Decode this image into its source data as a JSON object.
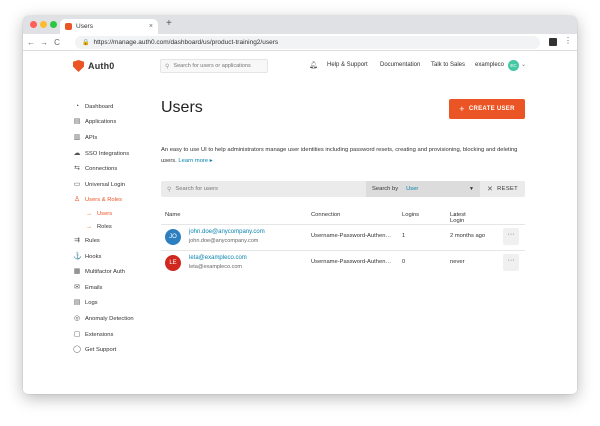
{
  "browser": {
    "tab_title": "Users",
    "tab_close": "×",
    "new_tab": "+",
    "url": "https://manage.auth0.com/dashboard/us/product-training2/users",
    "back": "←",
    "forward": "→",
    "reload": "C",
    "lock": "🔒",
    "menu": "⋮"
  },
  "header": {
    "logo_text": "Auth0",
    "search_placeholder": "Search for users or applications",
    "links": [
      "Help & Support",
      "Documentation",
      "Talk to Sales"
    ],
    "tenant_name": "exampleco",
    "tenant_initials": "EC",
    "tenant_caret": "⌄"
  },
  "sidebar": {
    "items": [
      {
        "label": "Dashboard",
        "icon": "◔"
      },
      {
        "label": "Applications",
        "icon": "▤"
      },
      {
        "label": "APIs",
        "icon": "▥"
      },
      {
        "label": "SSO Integrations",
        "icon": "☁"
      },
      {
        "label": "Connections",
        "icon": "⇆"
      },
      {
        "label": "Universal Login",
        "icon": "▭"
      },
      {
        "label": "Users & Roles",
        "icon": "♙"
      }
    ],
    "sub_items": [
      {
        "label": "Users",
        "arrow": "→"
      },
      {
        "label": "Roles",
        "arrow": "→"
      }
    ],
    "items_after": [
      {
        "label": "Rules",
        "icon": "⇉"
      },
      {
        "label": "Hooks",
        "icon": "⚓"
      },
      {
        "label": "Multifactor Auth",
        "icon": "▦"
      },
      {
        "label": "Emails",
        "icon": "✉"
      },
      {
        "label": "Logs",
        "icon": "▤"
      },
      {
        "label": "Anomaly Detection",
        "icon": "◎"
      },
      {
        "label": "Extensions",
        "icon": "▢"
      },
      {
        "label": "Get Support",
        "icon": "◯"
      }
    ]
  },
  "main": {
    "title": "Users",
    "create_button": "CREATE USER",
    "create_plus": "+",
    "description": "An easy to use UI to help administrators manage user identities including password resets, creating and provisioning, blocking and deleting users.",
    "learn_more": "Learn more ▸",
    "search_placeholder": "Search for users",
    "search_by_label": "Search by",
    "search_by_value": "User",
    "search_by_caret": "▼",
    "reset": "RESET",
    "reset_icon": "✕",
    "columns": {
      "name": "Name",
      "connection": "Connection",
      "logins": "Logins",
      "latest_login": "Latest Login",
      "sort_indicator": "↓"
    },
    "users": [
      {
        "initials": "JO",
        "avatar_color": "#2e7fc0",
        "email": "john.doe@anycompany.com",
        "email_sub": "john.doe@anycompany.com",
        "connection": "Username-Password-Authen…",
        "logins": "1",
        "latest_login": "2 months ago",
        "more": "···"
      },
      {
        "initials": "LE",
        "avatar_color": "#d0281f",
        "email": "leta@exampleco.com",
        "email_sub": "leta@exampleco.com",
        "connection": "Username-Password-Authen…",
        "logins": "0",
        "latest_login": "never",
        "more": "···"
      }
    ]
  },
  "colors": {
    "brand": "#eb5424",
    "link": "#0a84ae"
  }
}
